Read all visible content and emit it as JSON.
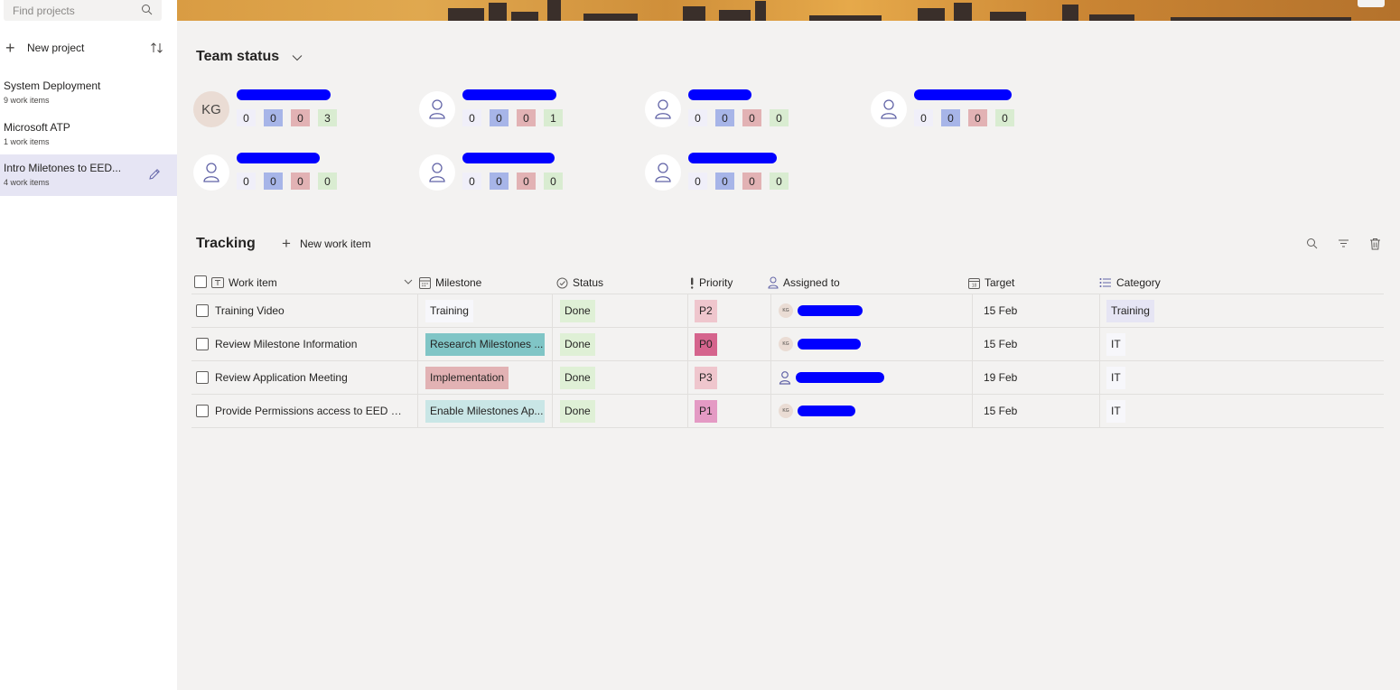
{
  "sidebar": {
    "search_placeholder": "Find projects",
    "new_project_label": "New project",
    "projects": [
      {
        "name": "System Deployment",
        "count": "9 work items"
      },
      {
        "name": "Microsoft ATP",
        "count": "1 work items"
      },
      {
        "name": "Intro Miletones to EED...",
        "count": "4 work items",
        "active": true
      }
    ]
  },
  "team": {
    "title": "Team status",
    "members": [
      {
        "initials": "KG",
        "counts": [
          "0",
          "0",
          "0",
          "3"
        ]
      },
      {
        "initials": "",
        "counts": [
          "0",
          "0",
          "0",
          "1"
        ]
      },
      {
        "initials": "",
        "counts": [
          "0",
          "0",
          "0",
          "0"
        ]
      },
      {
        "initials": "",
        "counts": [
          "0",
          "0",
          "0",
          "0"
        ]
      },
      {
        "initials": "",
        "counts": [
          "0",
          "0",
          "0",
          "0"
        ]
      },
      {
        "initials": "",
        "counts": [
          "0",
          "0",
          "0",
          "0"
        ]
      },
      {
        "initials": "",
        "counts": [
          "0",
          "0",
          "0",
          "0"
        ]
      }
    ]
  },
  "tracking": {
    "title": "Tracking",
    "new_work_item_label": "New work item",
    "columns": [
      "Work item",
      "Milestone",
      "Status",
      "Priority",
      "Assigned to",
      "Target",
      "Category"
    ],
    "rows": [
      {
        "work_item": "Training Video",
        "milestone": "Training",
        "milestone_color": "#f7f7fb",
        "status": "Done",
        "priority": "P2",
        "priority_color": "#efc6cd",
        "assignee_initials": "KG",
        "target": "15 Feb",
        "category": "Training",
        "category_color": "#e6e5f4"
      },
      {
        "work_item": "Review Milestone Information",
        "milestone": "Research Milestones ...",
        "milestone_color": "#80c5c6",
        "status": "Done",
        "priority": "P0",
        "priority_color": "#d5648d",
        "assignee_initials": "KG",
        "target": "15 Feb",
        "category": "IT",
        "category_color": "#f7f7fb"
      },
      {
        "work_item": "Review Application Meeting",
        "milestone": "Implementation",
        "milestone_color": "#e2b2b4",
        "status": "Done",
        "priority": "P3",
        "priority_color": "#efc6cd",
        "assignee_initials": "",
        "target": "19 Feb",
        "category": "IT",
        "category_color": "#f7f7fb"
      },
      {
        "work_item": "Provide Permissions access to EED Gro...",
        "milestone": "Enable Milestones Ap...",
        "milestone_color": "#c9e6e6",
        "status": "Done",
        "priority": "P1",
        "priority_color": "#e49ac4",
        "assignee_initials": "KG",
        "target": "15 Feb",
        "category": "IT",
        "category_color": "#f7f7fb"
      }
    ]
  },
  "colors": {
    "accent": "#6264a7",
    "status_done": "#dff0d6",
    "redaction": "#0000ff"
  }
}
